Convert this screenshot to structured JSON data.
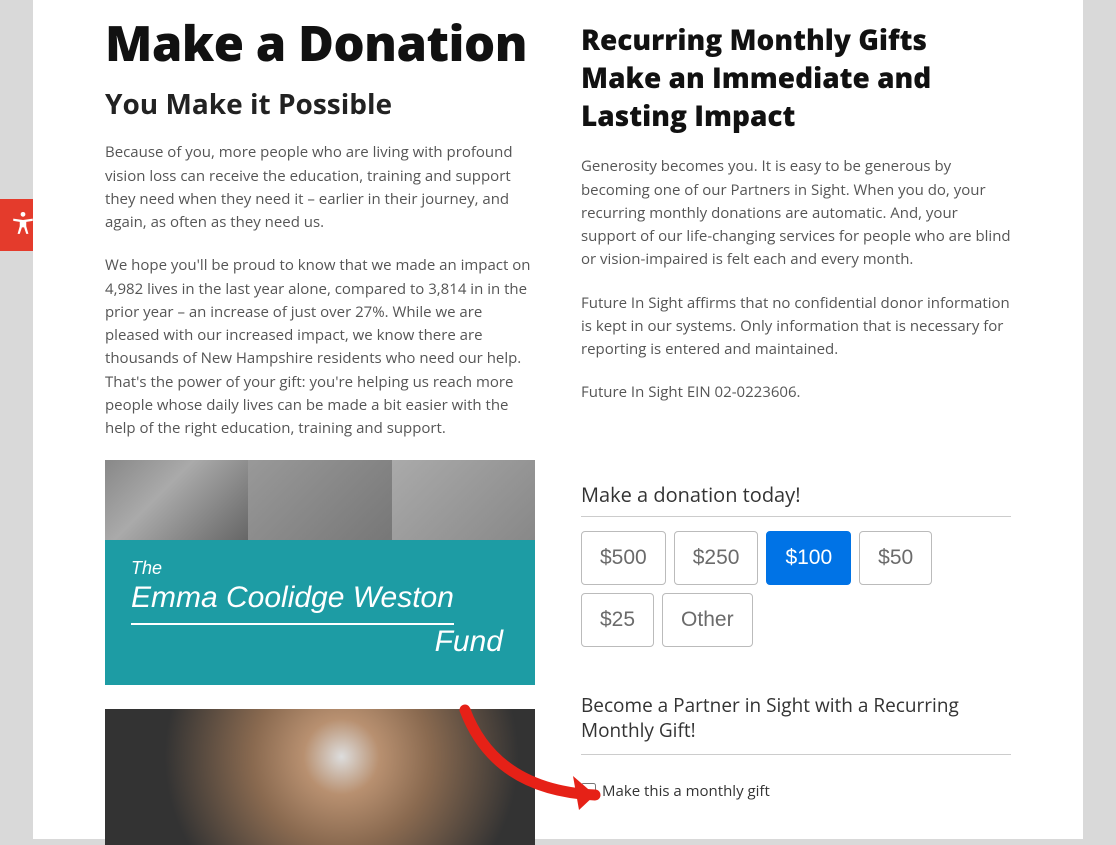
{
  "left": {
    "title": "Make a Donation",
    "subheading": "You Make it Possible",
    "p1": "Because of you, more people who are living with profound vision loss can receive the education, training and support they need when they need it – earlier in their journey, and again, as often as they need us.",
    "p2": "We hope you'll be proud to know that we made an impact on 4,982 lives in the last year alone, compared to 3,814 in in the prior year – an increase of just over 27%. While we are pleased with our increased impact, we know there are thousands of New Hampshire residents who need our help. That's the power of your gift: you're helping us reach more people whose daily lives can be made a bit easier with the help of the right education, training and support.",
    "fund": {
      "line1": "The",
      "line2": "Emma Coolidge Weston",
      "line3": "Fund"
    }
  },
  "right": {
    "heading": "Recurring Monthly Gifts Make an Immediate and Lasting Impact",
    "p1": "Generosity becomes you. It is easy to be generous by becoming one of our Partners in Sight. When you do, your recurring monthly donations are automatic. And, your support of our life-changing services for people who are blind or vision-impaired is felt each and every month.",
    "p2": "Future In Sight affirms that no confidential donor information is kept in our systems. Only information that is necessary for reporting is entered and maintained.",
    "ein": "Future In Sight EIN 02-0223606."
  },
  "form": {
    "title": "Make a donation today!",
    "amounts": [
      "$500",
      "$250",
      "$100",
      "$50",
      "$25",
      "Other"
    ],
    "selected_index": 2,
    "section2_title": "Become a Partner in Sight with a Recurring Monthly Gift!",
    "monthly_label": "Make this a monthly gift"
  }
}
